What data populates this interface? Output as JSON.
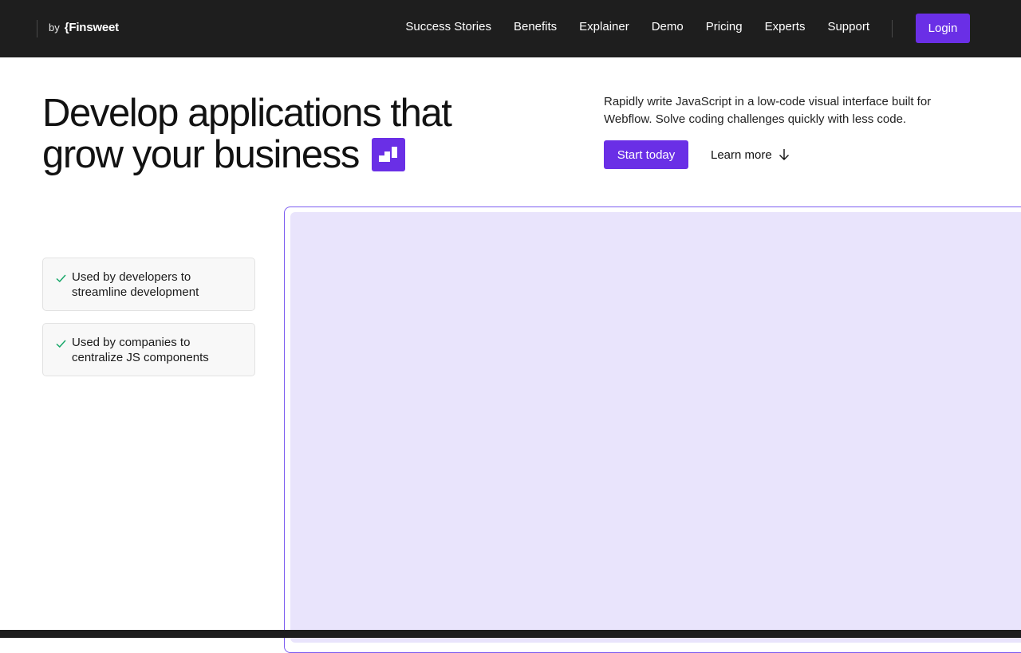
{
  "brand": {
    "by": "by",
    "name": "{Finsweet"
  },
  "nav": {
    "links": [
      "Success Stories",
      "Benefits",
      "Explainer",
      "Demo",
      "Pricing",
      "Experts",
      "Support"
    ],
    "login": "Login"
  },
  "hero": {
    "headline_line1": "Develop applications that",
    "headline_line2": "grow your business",
    "headline_icon": "stairs-icon",
    "subtext": "Rapidly write JavaScript in a low-code visual interface built for Webflow. Solve coding challenges quickly with less code.",
    "cta_primary": "Start today",
    "cta_secondary": "Learn more",
    "cta_secondary_icon": "arrow-down-icon"
  },
  "features": [
    {
      "icon": "check-icon",
      "text": "Used by developers to streamline development"
    },
    {
      "icon": "check-icon",
      "text": "Used by companies to centralize JS components"
    }
  ],
  "colors": {
    "accent": "#6a2fe6",
    "nav_bg": "#1e1e1e",
    "demo_bg": "#e9e4fc",
    "check": "#1aa86b"
  }
}
